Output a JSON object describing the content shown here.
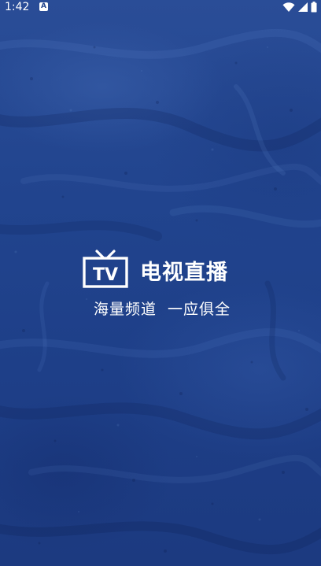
{
  "status_bar": {
    "time": "1:42",
    "notification_glyph": "A",
    "icons": [
      "wifi-icon",
      "cellular-signal-icon",
      "battery-icon"
    ]
  },
  "splash": {
    "logo_icon": "tv-icon",
    "logo_text": "TV",
    "title": "电视直播",
    "tagline": "海量频道  一应俱全",
    "background_color": "#21448e",
    "text_color": "#ffffff"
  }
}
